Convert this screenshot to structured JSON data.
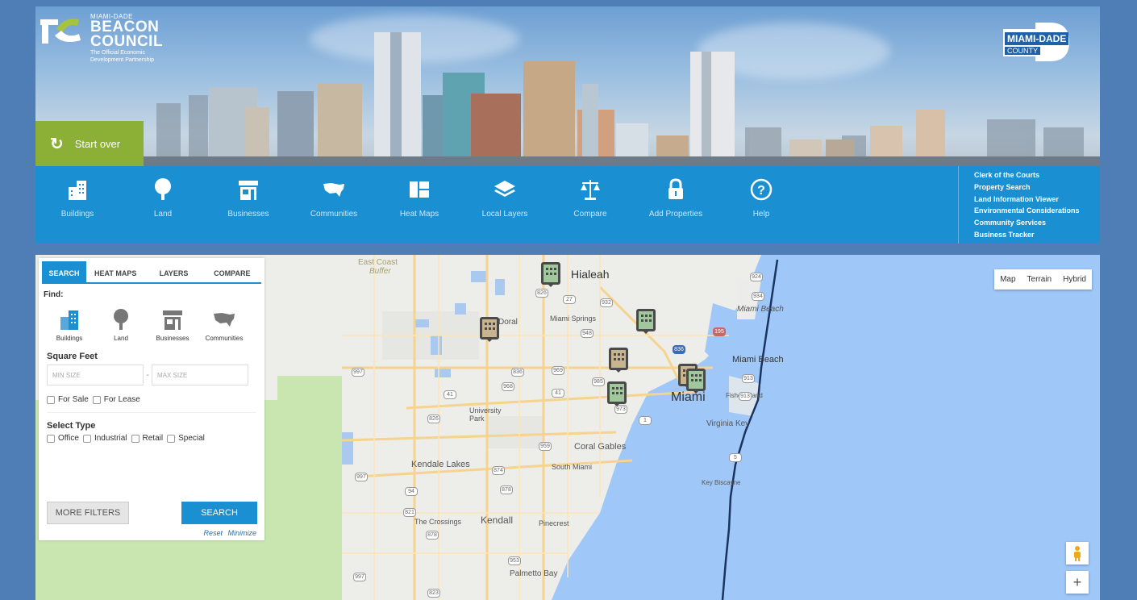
{
  "header": {
    "logo_line1": "MIAMI-DADE",
    "logo_line2": "BEACON",
    "logo_line3": "COUNCIL",
    "logo_tagline1": "The Official Economic",
    "logo_tagline2": "Development Partnership",
    "county_name": "MIAMI-DADE",
    "county_sub": "COUNTY",
    "start_over": "Start over"
  },
  "toolbar": {
    "items": [
      {
        "label": "Buildings",
        "icon": "buildings-icon"
      },
      {
        "label": "Land",
        "icon": "tree-icon"
      },
      {
        "label": "Businesses",
        "icon": "storefront-icon"
      },
      {
        "label": "Communities",
        "icon": "usa-map-icon"
      },
      {
        "label": "Heat Maps",
        "icon": "heatmap-grid-icon"
      },
      {
        "label": "Local Layers",
        "icon": "layers-icon"
      },
      {
        "label": "Compare",
        "icon": "scales-icon"
      },
      {
        "label": "Add Properties",
        "icon": "lock-icon"
      },
      {
        "label": "Help",
        "icon": "question-circle-icon"
      }
    ],
    "quick_links": [
      "Clerk of the Courts",
      "Property Search",
      "Land Information Viewer",
      "Environmental Considerations",
      "Community Services",
      "Business Tracker"
    ]
  },
  "panel": {
    "tabs": [
      "SEARCH",
      "HEAT MAPS",
      "LAYERS",
      "COMPARE"
    ],
    "find_label": "Find:",
    "categories": [
      "Buildings",
      "Land",
      "Businesses",
      "Communities"
    ],
    "square_feet_label": "Square Feet",
    "min_placeholder": "MIN SIZE",
    "max_placeholder": "MAX SIZE",
    "for_sale": "For Sale",
    "for_lease": "For Lease",
    "select_type_label": "Select Type",
    "types": [
      "Office",
      "Industrial",
      "Retail",
      "Special"
    ],
    "more_filters": "MORE FILTERS",
    "search": "SEARCH",
    "reset": "Reset",
    "minimize": "Minimize"
  },
  "map": {
    "map_types": [
      "Map",
      "Terrain",
      "Hybrid"
    ],
    "zoom_in": "+",
    "labels": {
      "east_coast": "East Coast",
      "buffer": "Buffer",
      "hialeah": "Hialeah",
      "miami_springs": "Miami Springs",
      "miami_beach_n": "Miami Beach",
      "miami_beach": "Miami Beach",
      "miami": "Miami",
      "fisher_island": "Fisher Island",
      "virginia_key": "Virginia Key",
      "university_park": "University Park",
      "coral_gables": "Coral Gables",
      "kendale_lakes": "Kendale Lakes",
      "south_miami": "South Miami",
      "key_biscayne": "Key Biscayne",
      "the_crossings": "The Crossings",
      "kendall": "Kendall",
      "pinecrest": "Pinecrest",
      "palmetto_bay": "Palmetto Bay",
      "doral": "Doral"
    },
    "shields": [
      "924",
      "27",
      "932",
      "934",
      "826",
      "948",
      "195",
      "836",
      "997",
      "836",
      "969",
      "968",
      "41",
      "41",
      "985",
      "973",
      "1",
      "913",
      "913",
      "826",
      "959",
      "874",
      "997",
      "94",
      "878",
      "821",
      "878",
      "997",
      "5",
      "953",
      "823",
      "27"
    ]
  }
}
